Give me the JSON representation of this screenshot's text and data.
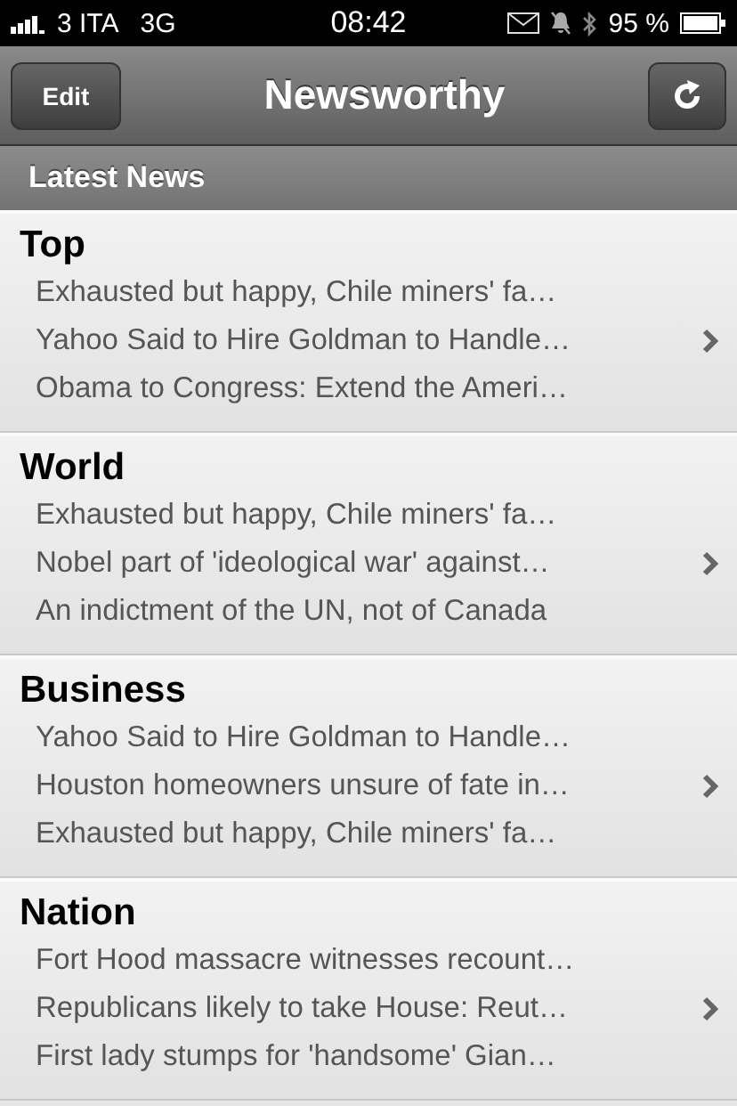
{
  "status_bar": {
    "carrier": "3 ITA",
    "network": "3G",
    "time": "08:42",
    "battery": "95 %"
  },
  "nav_bar": {
    "left_button": "Edit",
    "title": "Newsworthy"
  },
  "section_header": "Latest News",
  "categories": [
    {
      "title": "Top",
      "headlines": [
        "Exhausted but happy, Chile miners' fa…",
        "Yahoo Said to Hire Goldman to Handle…",
        "Obama to Congress: Extend the Ameri…"
      ]
    },
    {
      "title": "World",
      "headlines": [
        "Exhausted but happy, Chile miners' fa…",
        "Nobel part of 'ideological war' against…",
        "An indictment of the UN, not of Canada"
      ]
    },
    {
      "title": "Business",
      "headlines": [
        "Yahoo Said to Hire Goldman to Handle…",
        "Houston homeowners unsure of fate in…",
        "Exhausted but happy, Chile miners' fa…"
      ]
    },
    {
      "title": "Nation",
      "headlines": [
        "Fort Hood massacre witnesses recount…",
        "Republicans likely to take House: Reut…",
        "First lady stumps for 'handsome' Gian…"
      ]
    }
  ]
}
